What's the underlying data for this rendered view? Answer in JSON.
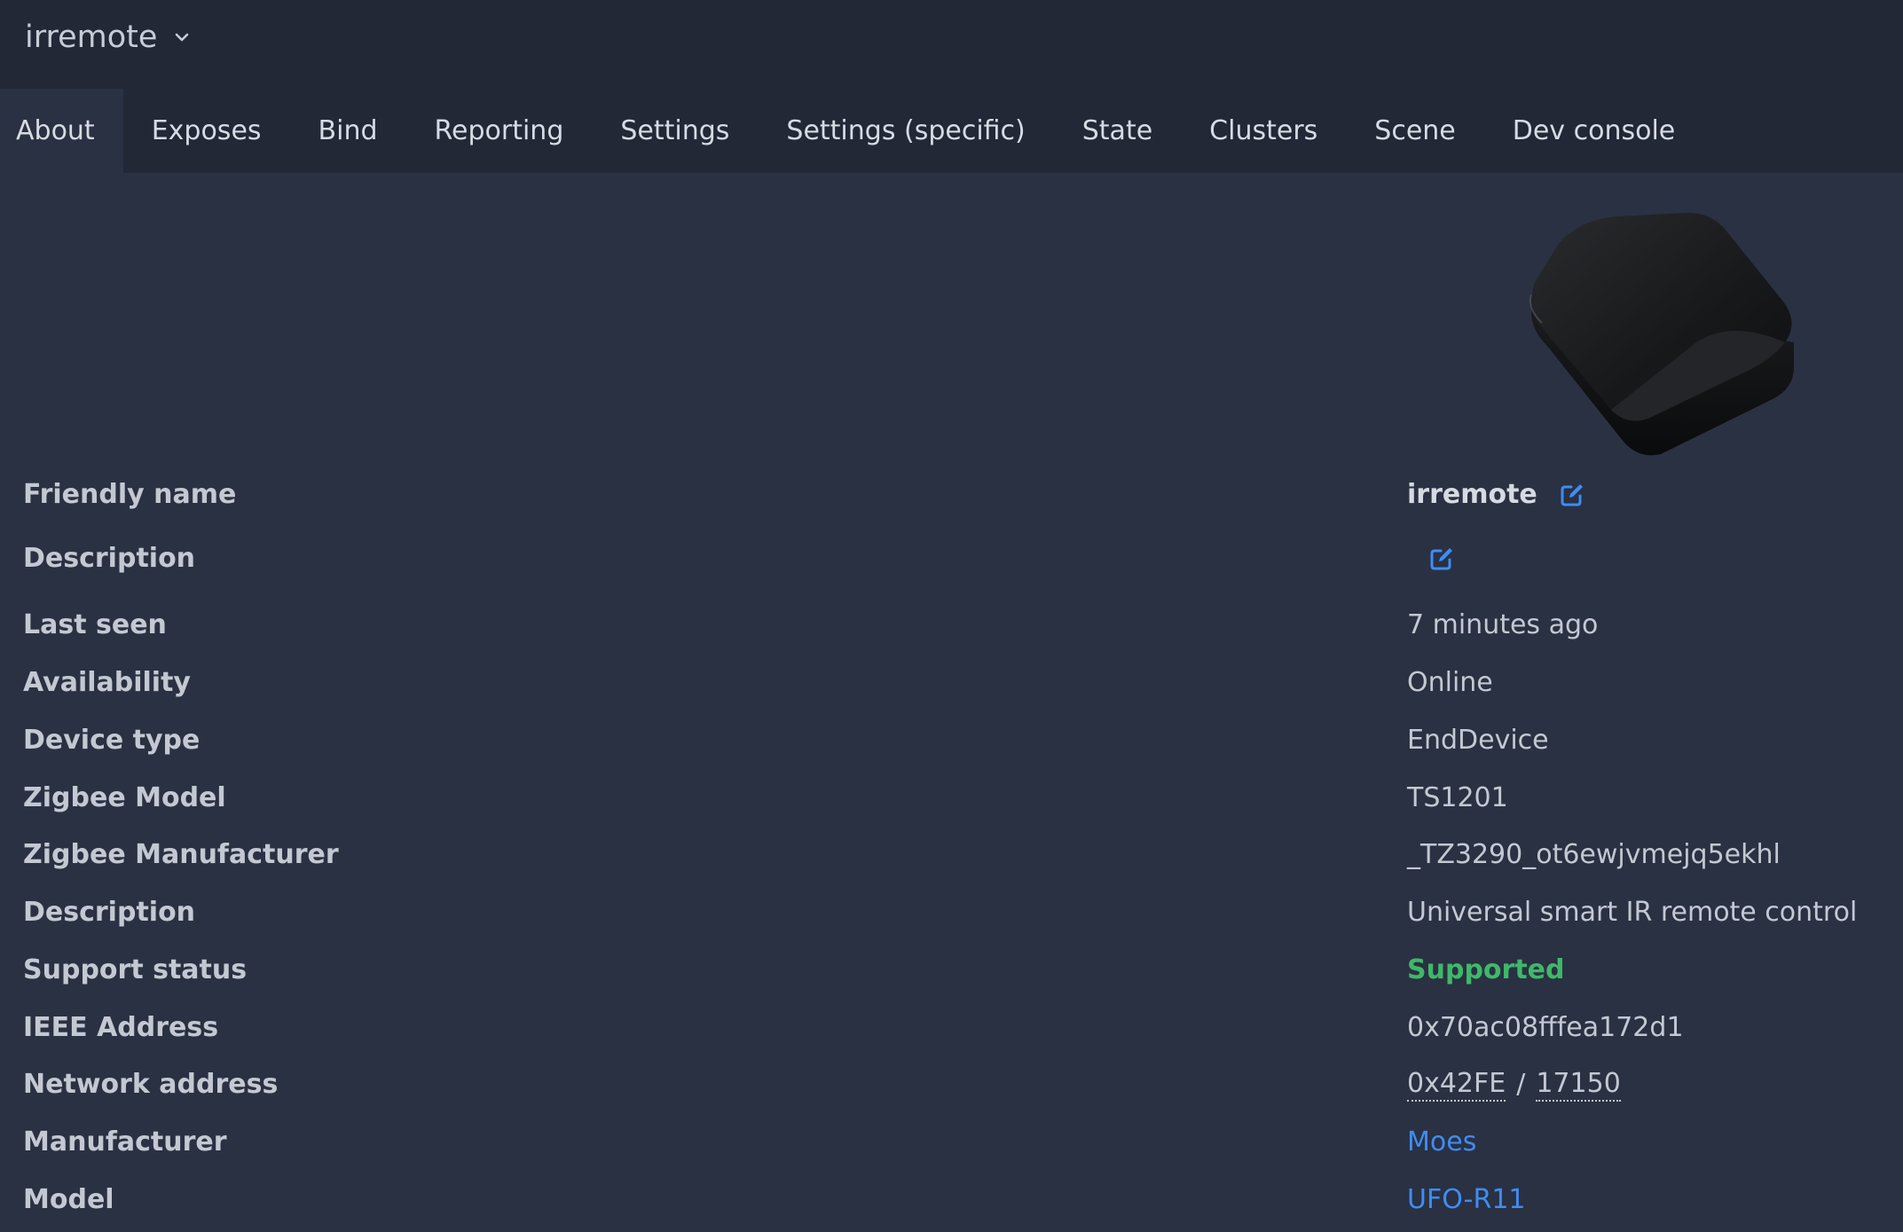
{
  "header": {
    "device_name": "irremote"
  },
  "tabs": [
    {
      "label": "About",
      "active": true
    },
    {
      "label": "Exposes"
    },
    {
      "label": "Bind"
    },
    {
      "label": "Reporting"
    },
    {
      "label": "Settings"
    },
    {
      "label": "Settings (specific)"
    },
    {
      "label": "State"
    },
    {
      "label": "Clusters"
    },
    {
      "label": "Scene"
    },
    {
      "label": "Dev console"
    }
  ],
  "about": {
    "friendly_name": {
      "label": "Friendly name",
      "value": "irremote"
    },
    "description_edit": {
      "label": "Description",
      "value": ""
    },
    "last_seen": {
      "label": "Last seen",
      "value": "7 minutes ago"
    },
    "availability": {
      "label": "Availability",
      "value": "Online"
    },
    "device_type": {
      "label": "Device type",
      "value": "EndDevice"
    },
    "zigbee_model": {
      "label": "Zigbee Model",
      "value": "TS1201"
    },
    "zigbee_manufacturer": {
      "label": "Zigbee Manufacturer",
      "value": "_TZ3290_ot6ewjvmejq5ekhl"
    },
    "description": {
      "label": "Description",
      "value": "Universal smart IR remote control"
    },
    "support_status": {
      "label": "Support status",
      "value": "Supported"
    },
    "ieee_address": {
      "label": "IEEE Address",
      "value": "0x70ac08fffea172d1"
    },
    "network_address": {
      "label": "Network address",
      "hex": "0x42FE",
      "separator": "/",
      "dec": "17150"
    },
    "manufacturer": {
      "label": "Manufacturer",
      "value": "Moes"
    },
    "model": {
      "label": "Model",
      "value": "UFO-R11"
    }
  },
  "colors": {
    "background": "#2a3142",
    "topbar": "#222836",
    "link": "#3f8cf5",
    "supported": "#3fb86a"
  },
  "icons": {
    "selector_chevron": "chevron-down-icon",
    "edit": "edit-icon"
  }
}
